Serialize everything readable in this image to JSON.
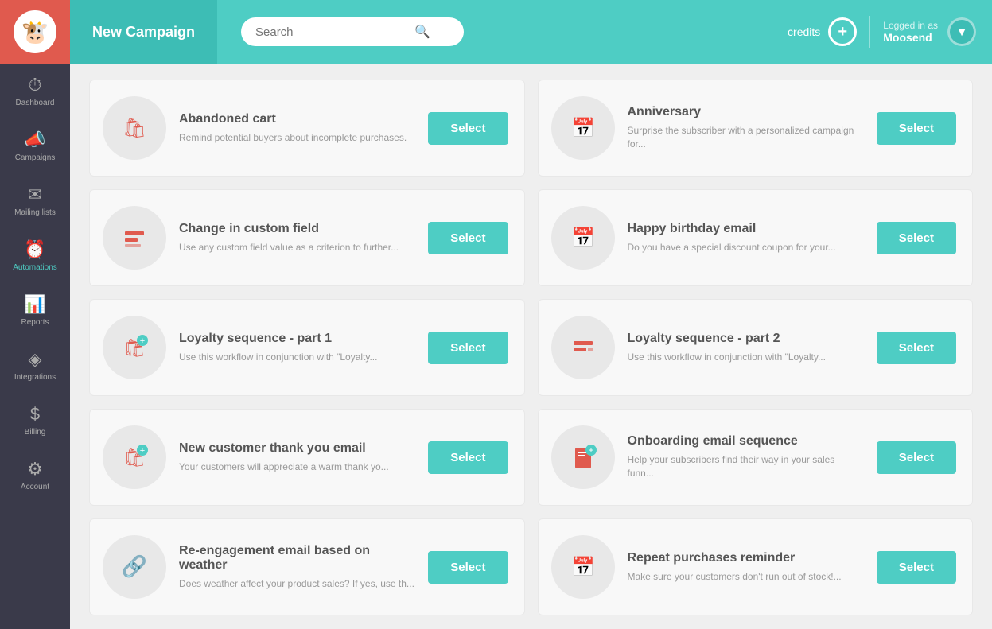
{
  "sidebar": {
    "logo": "🐮",
    "items": [
      {
        "id": "dashboard",
        "label": "Dashboard",
        "icon": "⏱",
        "active": false
      },
      {
        "id": "campaigns",
        "label": "Campaigns",
        "icon": "📢",
        "active": false
      },
      {
        "id": "mailing-lists",
        "label": "Mailing lists",
        "icon": "✉",
        "active": false
      },
      {
        "id": "automations",
        "label": "Automations",
        "icon": "⏰",
        "active": true
      },
      {
        "id": "reports",
        "label": "Reports",
        "icon": "📊",
        "active": false
      },
      {
        "id": "integrations",
        "label": "Integrations",
        "icon": "◇",
        "active": false
      },
      {
        "id": "billing",
        "label": "Billing",
        "icon": "$",
        "active": false
      },
      {
        "id": "account",
        "label": "Account",
        "icon": "⚙",
        "active": false
      }
    ]
  },
  "topbar": {
    "new_campaign": "New Campaign",
    "search_placeholder": "Search",
    "credits_label": "credits",
    "logged_in_label": "Logged in as",
    "username": "Moosend"
  },
  "campaigns": [
    {
      "id": "abandoned-cart",
      "title": "Abandoned cart",
      "description": "Remind potential buyers about incomplete purchases.",
      "icon_type": "cart",
      "select_label": "Select"
    },
    {
      "id": "anniversary",
      "title": "Anniversary",
      "description": "Surprise the subscriber with a personalized campaign for...",
      "icon_type": "calendar",
      "select_label": "Select"
    },
    {
      "id": "change-custom-field",
      "title": "Change in custom field",
      "description": "Use any custom field value as a criterion to further...",
      "icon_type": "field",
      "select_label": "Select"
    },
    {
      "id": "happy-birthday",
      "title": "Happy birthday email",
      "description": "Do you have a special discount coupon for your...",
      "icon_type": "calendar",
      "select_label": "Select"
    },
    {
      "id": "loyalty-1",
      "title": "Loyalty sequence - part 1",
      "description": "Use this workflow in conjunction with \"Loyalty...",
      "icon_type": "cart",
      "select_label": "Select"
    },
    {
      "id": "loyalty-2",
      "title": "Loyalty sequence - part 2",
      "description": "Use this workflow in conjunction with \"Loyalty...",
      "icon_type": "field",
      "select_label": "Select"
    },
    {
      "id": "new-customer-thank-you",
      "title": "New customer thank you email",
      "description": "Your customers will appreciate a warm thank yo...",
      "icon_type": "cart",
      "select_label": "Select"
    },
    {
      "id": "onboarding",
      "title": "Onboarding email sequence",
      "description": "Help your subscribers find their way in your sales funn...",
      "icon_type": "cart-plus",
      "select_label": "Select"
    },
    {
      "id": "reengagement",
      "title": "Re-engagement email based on weather",
      "description": "Does weather affect your product sales? If yes, use th...",
      "icon_type": "link",
      "select_label": "Select"
    },
    {
      "id": "repeat-purchases",
      "title": "Repeat purchases reminder",
      "description": "Make sure your customers don't run out of stock!...",
      "icon_type": "calendar",
      "select_label": "Select"
    }
  ]
}
